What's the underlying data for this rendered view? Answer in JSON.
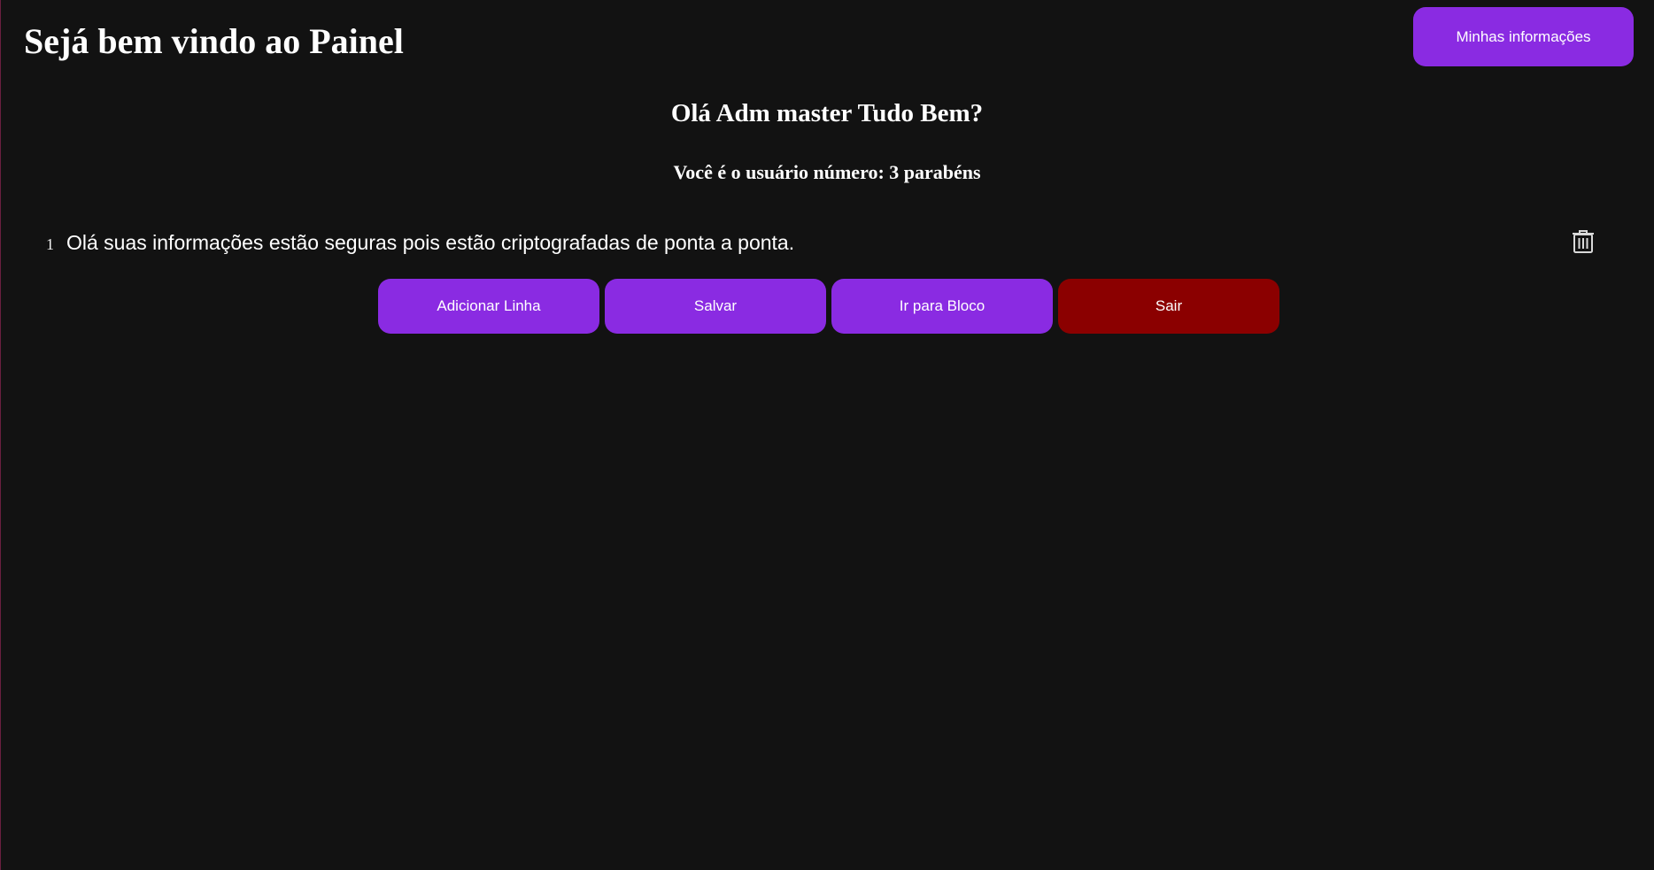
{
  "header": {
    "title": "Sejá bem vindo ao Painel",
    "info_button_label": "Minhas informações"
  },
  "greeting": {
    "title": "Olá Adm master Tudo Bem?",
    "user_number_text": "Você é o usuário número: 3 parabéns"
  },
  "lines": [
    {
      "number": "1",
      "text": "Olá suas informações estão seguras pois estão criptografadas de ponta a ponta.",
      "delete_icon": "trash-icon"
    }
  ],
  "actions": {
    "add_line_label": "Adicionar Linha",
    "save_label": "Salvar",
    "go_to_block_label": "Ir para Bloco",
    "exit_label": "Sair"
  },
  "colors": {
    "background": "#121212",
    "primary_button": "#8a2be2",
    "exit_button": "#8b0000",
    "text": "#ffffff",
    "icon": "#d9d9d9"
  }
}
